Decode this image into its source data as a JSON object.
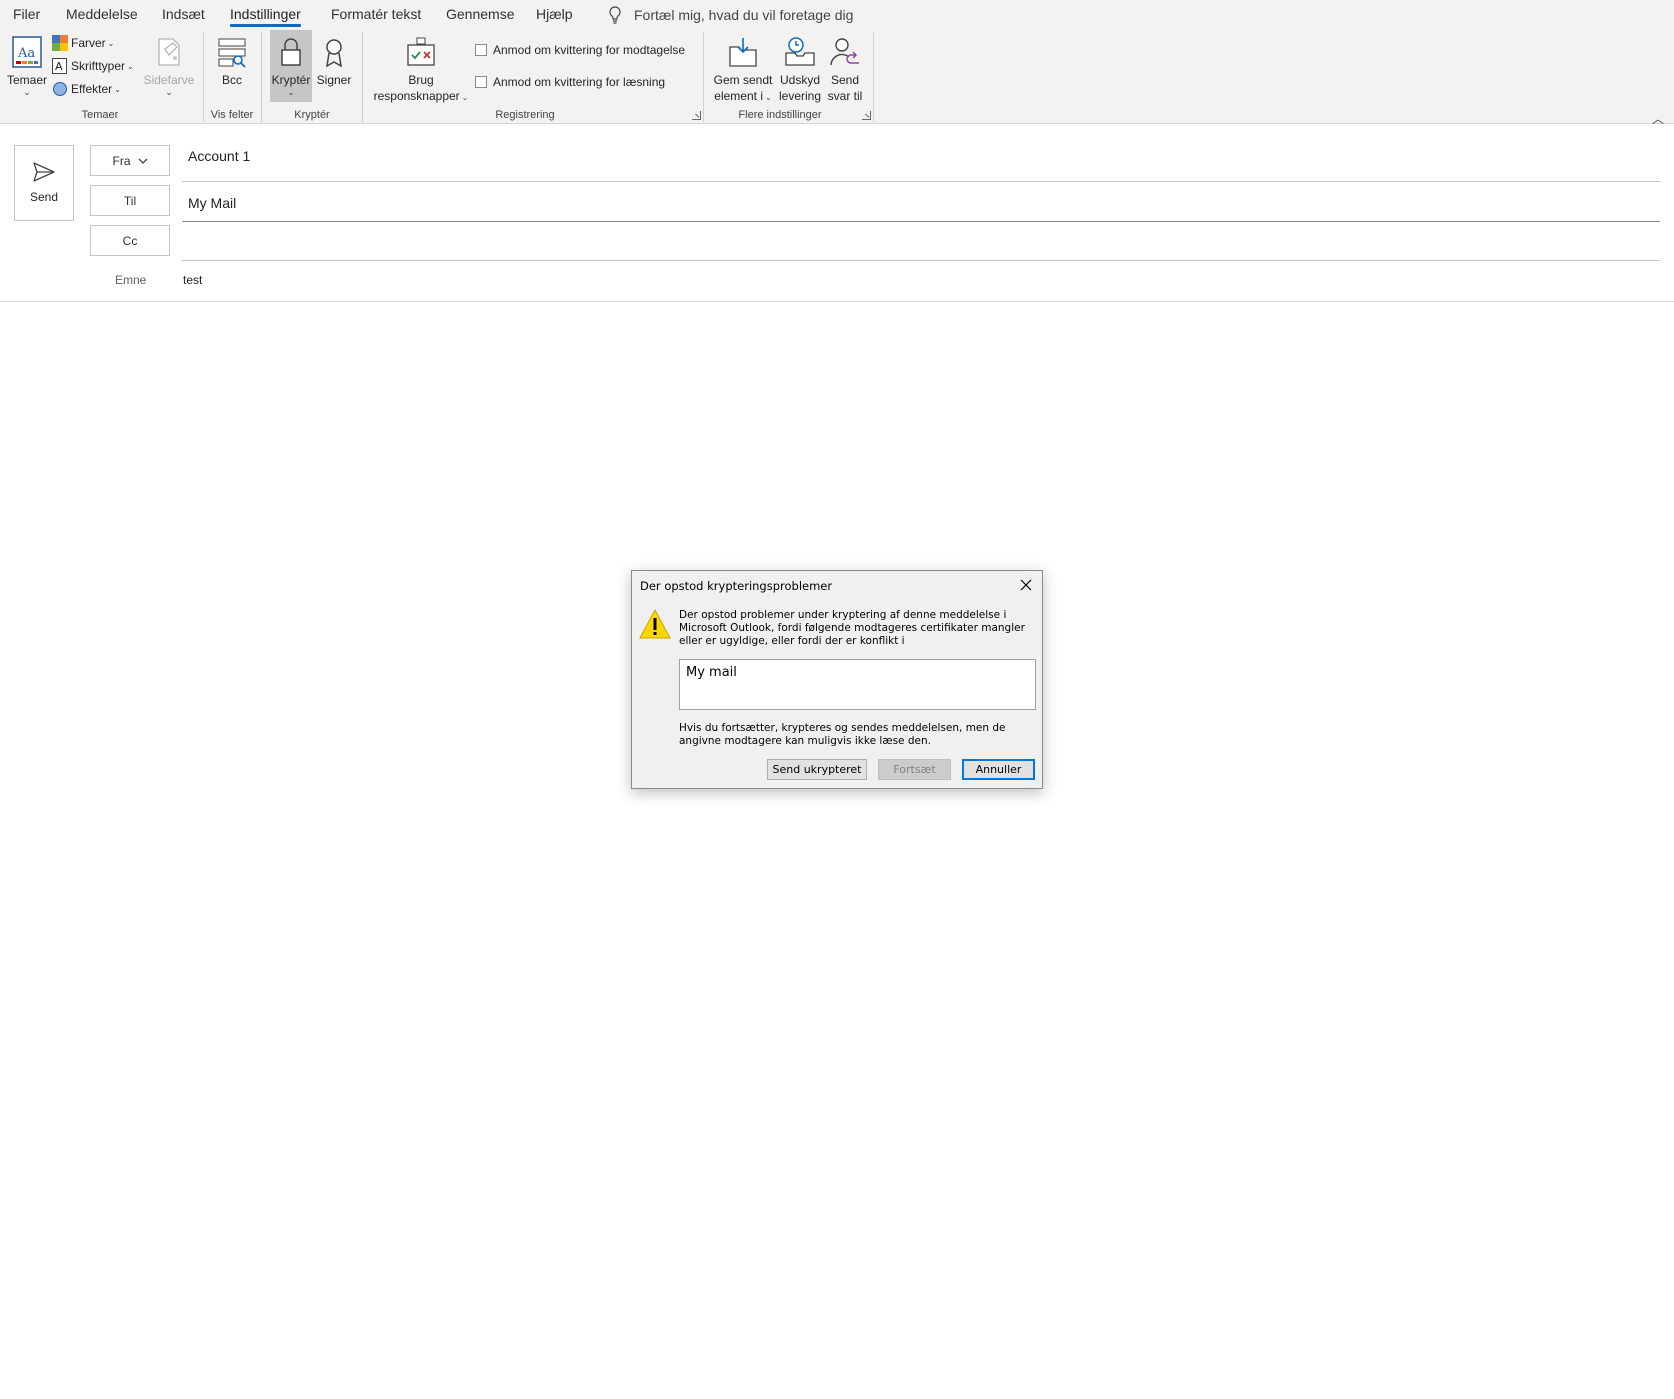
{
  "tabs": [
    {
      "label": "Filer",
      "active": false
    },
    {
      "label": "Meddelelse",
      "active": false
    },
    {
      "label": "Indsæt",
      "active": false
    },
    {
      "label": "Indstillinger",
      "active": true
    },
    {
      "label": "Formatér tekst",
      "active": false
    },
    {
      "label": "Gennemse",
      "active": false
    },
    {
      "label": "Hjælp",
      "active": false
    }
  ],
  "tellme": "Fortæl mig, hvad du vil foretage dig",
  "ribbon": {
    "themes": {
      "temaer": "Temaer",
      "farver": "Farver",
      "skrifttyper": "Skrifttyper",
      "effekter": "Effekter",
      "sidefarve": "Sidefarve",
      "group": "Temaer"
    },
    "fields": {
      "bcc": "Bcc",
      "group": "Vis felter"
    },
    "encrypt": {
      "kryptér": "Kryptér",
      "signer": "Signer",
      "group": "Kryptér"
    },
    "tracking": {
      "brug_line1": "Brug",
      "brug_line2": "responsknapper",
      "receipt_delivery": "Anmod om kvittering for modtagelse",
      "receipt_read": "Anmod om kvittering for læsning",
      "group": "Registrering"
    },
    "more": {
      "gem_line1": "Gem sendt",
      "gem_line2": "element i",
      "udskyd_line1": "Udskyd",
      "udskyd_line2": "levering",
      "svar_line1": "Send",
      "svar_line2": "svar til",
      "group": "Flere indstillinger"
    }
  },
  "compose": {
    "send": "Send",
    "from_label": "Fra",
    "from_value": "Account 1",
    "to_label": "Til",
    "to_value": "My Mail",
    "cc_label": "Cc",
    "cc_value": "",
    "subject_label": "Emne",
    "subject_value": "test"
  },
  "dialog": {
    "title": "Der opstod krypteringsproblemer",
    "message": "Der opstod problemer under kryptering af denne meddelelse i Microsoft Outlook, fordi følgende modtageres certifikater mangler eller er ugyldige, eller fordi der er konflikt i",
    "recipients": "My mail",
    "note": "Hvis du fortsætter, krypteres og sendes meddelelsen, men de angivne modtagere kan muligvis ikke læse den.",
    "btn_send_unencrypted": "Send ukrypteret",
    "btn_continue": "Fortsæt",
    "btn_cancel": "Annuller"
  },
  "colors": {
    "accent": "#0f6cbd",
    "ribbon_bg": "#f3f2f1",
    "dialog_bg": "#f0f0f0",
    "dialog_default_border": "#0078d7"
  }
}
